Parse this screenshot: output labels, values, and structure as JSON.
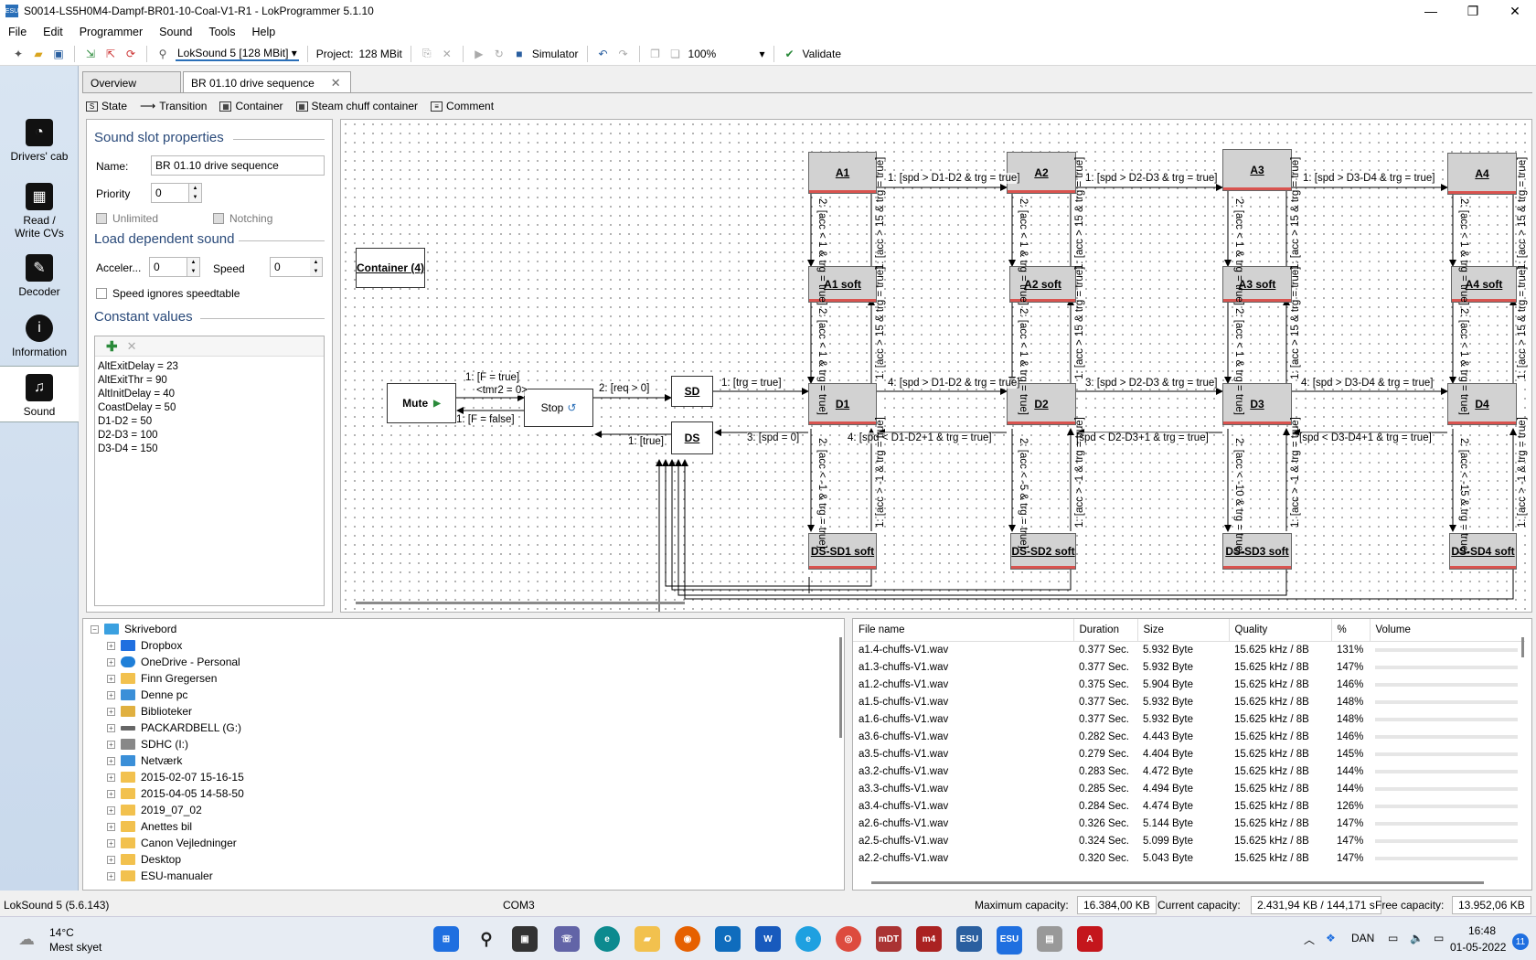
{
  "window": {
    "title": "S0014-LS5H0M4-Dampf-BR01-10-Coal-V1-R1 - LokProgrammer 5.1.10",
    "minimize": "—",
    "maximize": "❐",
    "close": "✕"
  },
  "menu": [
    "File",
    "Edit",
    "Programmer",
    "Sound",
    "Tools",
    "Help"
  ],
  "toolbar": {
    "decoder": "LokSound 5 [128 MBit]",
    "project_label": "Project:",
    "project_size": "128 MBit",
    "simulator": "Simulator",
    "zoom": "100%",
    "validate": "Validate"
  },
  "nav": [
    {
      "label": "Drivers' cab",
      "icon": "speedometer-icon"
    },
    {
      "label": "Read / Write CVs",
      "icon": "cv-icon"
    },
    {
      "label": "Decoder",
      "icon": "wrench-icon"
    },
    {
      "label": "Information",
      "icon": "info-icon"
    },
    {
      "label": "Sound",
      "icon": "music-note-icon"
    }
  ],
  "tabs": [
    {
      "label": "Overview"
    },
    {
      "label": "BR 01.10 drive sequence"
    }
  ],
  "editor_tools": [
    "State",
    "Transition",
    "Container",
    "Steam chuff container",
    "Comment"
  ],
  "props": {
    "title": "Sound slot properties",
    "name_label": "Name:",
    "name_value": "BR 01.10 drive sequence",
    "priority_label": "Priority",
    "priority_value": "0",
    "unlimited": "Unlimited",
    "notching": "Notching",
    "load_title": "Load dependent sound",
    "accel_label": "Acceler...",
    "accel_value": "0",
    "speed_label": "Speed",
    "speed_value": "0",
    "ignore_label": "Speed ignores speedtable",
    "const_title": "Constant values",
    "constants": [
      "AltExitDelay = 23",
      "AltExitThr = 90",
      "AltInitDelay = 40",
      "CoastDelay = 50",
      "D1-D2 = 50",
      "D2-D3 = 100",
      "D3-D4 = 150"
    ]
  },
  "diagram": {
    "nodes": {
      "container": "Container (4)",
      "mute": "Mute",
      "stop": "Stop",
      "sd": "SD",
      "ds": "DS",
      "a1": "A1",
      "a2": "A2",
      "a3": "A3",
      "a4": "A4",
      "a1s": "A1 soft",
      "a2s": "A2 soft",
      "a3s": "A3 soft",
      "a4s": "A4 soft",
      "d1": "D1",
      "d2": "D2",
      "d3": "D3",
      "d4": "D4",
      "ds1": "DS-SD1 soft",
      "ds2": "DS-SD2 soft",
      "ds3": "DS-SD3 soft",
      "ds4": "DS-SD4 soft"
    },
    "labels": {
      "mute_stop": "1: [F = true]",
      "tmr": "<tmr2 = 0>",
      "stop_mute": "1: [F = false]",
      "stop_sd": "2: [req > 0]",
      "ds_stop": "1: [true]",
      "sd_d1": "1: [trg = true]",
      "d1_ds": "3: [spd = 0]",
      "a1_a2": "1: [spd > D1-D2 & trg = true]",
      "a2_a3": "1: [spd > D2-D3 & trg = true]",
      "a3_a4": "1: [spd > D3-D4 & trg = true]",
      "d1_d2": "4: [spd > D1-D2 & trg = true]",
      "d2_d3": "3: [spd > D2-D3 & trg = true]",
      "d3_d4": "4: [spd > D3-D4 & trg = true]",
      "d2_d1": "4: [spd < D1-D2+1 & trg = true]",
      "d3_d2": "[spd < D2-D3+1 & trg = true]",
      "d4_d3": "[spd < D3-D4+1 & trg = true]",
      "v_a_down": "2: [acc < 1 & trg = true]",
      "v_a_up": "1: [acc > 15 & trg = true]",
      "v_s_down": "2: [acc < 1 & trg = true]",
      "v_s_up": "1: [acc > 15 & trg = true]",
      "v_d_down1": "2: [acc < -1 & trg = true]",
      "v_d_up1": "1: [acc > -1 & trg = true]",
      "v_d_down2": "2: [acc < -5 & trg = true]",
      "v_d_down3": "2: [acc < -10 & trg = true]",
      "v_d_down4": "2: [acc < -15 & trg = true]"
    }
  },
  "tree": [
    "Skrivebord",
    "Dropbox",
    "OneDrive - Personal",
    "Finn Gregersen",
    "Denne pc",
    "Biblioteker",
    "PACKARDBELL (G:)",
    "SDHC (I:)",
    "Netværk",
    "2015-02-07 15-16-15",
    "2015-04-05 14-58-50",
    "2019_07_02",
    "Anettes bil",
    "Canon Vejledninger",
    "Desktop",
    "ESU-manualer"
  ],
  "files": {
    "headers": [
      "File name",
      "Duration",
      "Size",
      "Quality",
      "%",
      "Volume"
    ],
    "rows": [
      [
        "a1.4-chuffs-V1.wav",
        "0.377 Sec.",
        "5.932 Byte",
        "15.625 kHz / 8B",
        "131%"
      ],
      [
        "a1.3-chuffs-V1.wav",
        "0.377 Sec.",
        "5.932 Byte",
        "15.625 kHz / 8B",
        "147%"
      ],
      [
        "a1.2-chuffs-V1.wav",
        "0.375 Sec.",
        "5.904 Byte",
        "15.625 kHz / 8B",
        "146%"
      ],
      [
        "a1.5-chuffs-V1.wav",
        "0.377 Sec.",
        "5.932 Byte",
        "15.625 kHz / 8B",
        "148%"
      ],
      [
        "a1.6-chuffs-V1.wav",
        "0.377 Sec.",
        "5.932 Byte",
        "15.625 kHz / 8B",
        "148%"
      ],
      [
        "a3.6-chuffs-V1.wav",
        "0.282 Sec.",
        "4.443 Byte",
        "15.625 kHz / 8B",
        "146%"
      ],
      [
        "a3.5-chuffs-V1.wav",
        "0.279 Sec.",
        "4.404 Byte",
        "15.625 kHz / 8B",
        "145%"
      ],
      [
        "a3.2-chuffs-V1.wav",
        "0.283 Sec.",
        "4.472 Byte",
        "15.625 kHz / 8B",
        "144%"
      ],
      [
        "a3.3-chuffs-V1.wav",
        "0.285 Sec.",
        "4.494 Byte",
        "15.625 kHz / 8B",
        "144%"
      ],
      [
        "a3.4-chuffs-V1.wav",
        "0.284 Sec.",
        "4.474 Byte",
        "15.625 kHz / 8B",
        "126%"
      ],
      [
        "a2.6-chuffs-V1.wav",
        "0.326 Sec.",
        "5.144 Byte",
        "15.625 kHz / 8B",
        "147%"
      ],
      [
        "a2.5-chuffs-V1.wav",
        "0.324 Sec.",
        "5.099 Byte",
        "15.625 kHz / 8B",
        "147%"
      ],
      [
        "a2.2-chuffs-V1.wav",
        "0.320 Sec.",
        "5.043 Byte",
        "15.625 kHz / 8B",
        "147%"
      ]
    ]
  },
  "status": {
    "decoder": "LokSound 5 (5.6.143)",
    "port": "COM3",
    "max_label": "Maximum capacity:",
    "max_value": "16.384,00 KB",
    "cur_label": "Current capacity:",
    "cur_value": "2.431,94 KB / 144,171 s",
    "free_label": "Free capacity:",
    "free_value": "13.952,06 KB"
  },
  "taskbar": {
    "temp": "14°C",
    "weather": "Mest skyet",
    "lang": "DAN",
    "time": "16:48",
    "date": "01-05-2022",
    "badge": "11"
  }
}
